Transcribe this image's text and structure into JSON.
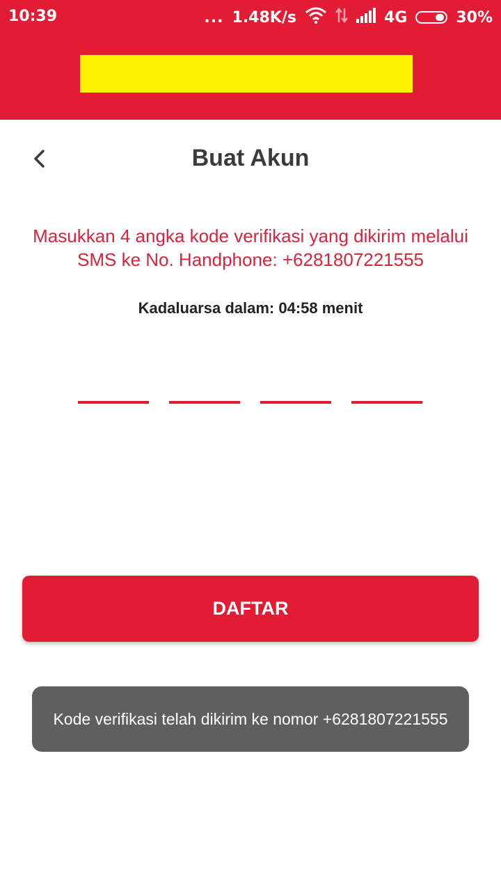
{
  "status_bar": {
    "time": "10:39",
    "net_dots": "...",
    "net_speed": "1.48K/s",
    "network_type": "4G",
    "battery": "30%",
    "icons": [
      "wifi-icon",
      "data-transfer-icon",
      "signal-icon",
      "battery-icon"
    ]
  },
  "header": {
    "background_color": "#e21c34",
    "logo_color": "#fff200"
  },
  "nav": {
    "back_icon": "chevron-left-icon",
    "title": "Buat Akun"
  },
  "verification": {
    "instruction": "Masukkan 4 angka kode verifikasi yang dikirim melalui SMS ke No. Handphone: +6281807221555",
    "expiry": "Kadaluarsa dalam: 04:58 menit",
    "digits": [
      "",
      "",
      "",
      ""
    ]
  },
  "actions": {
    "register_label": "DAFTAR"
  },
  "toast": {
    "message": "Kode verifikasi telah dikirim ke nomor +6281807221555"
  },
  "colors": {
    "accent": "#e21c34",
    "instruction_text": "#d9243b",
    "toast_bg": "#5f5f5f"
  }
}
